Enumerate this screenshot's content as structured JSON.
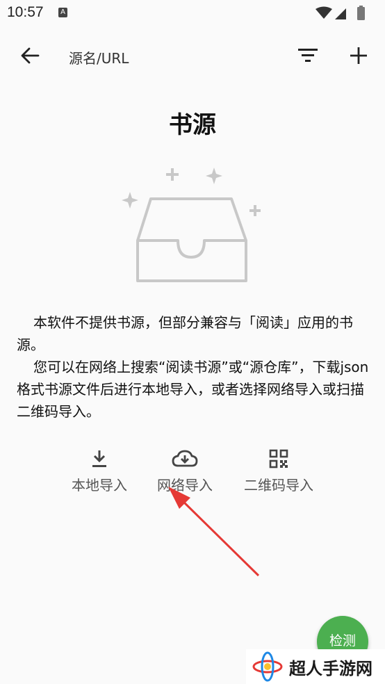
{
  "status_bar": {
    "time": "10:57",
    "notif_letter": "A"
  },
  "toolbar": {
    "back_icon": "arrow-left-icon",
    "search_text": "源名/URL",
    "filter_icon": "filter-icon",
    "add_icon": "plus-icon"
  },
  "page": {
    "title": "书源",
    "description_p1": "本软件不提供书源，但部分兼容与「阅读」应用的书源。",
    "description_p2": "您可以在网络上搜索“阅读书源”或“源仓库”，下载json格式书源文件后进行本地导入，或者选择网络导入或扫描二维码导入。"
  },
  "actions": [
    {
      "label": "本地导入",
      "icon": "download-icon"
    },
    {
      "label": "网络导入",
      "icon": "cloud-download-icon"
    },
    {
      "label": "二维码导入",
      "icon": "qr-code-icon"
    }
  ],
  "fab": {
    "label": "检测"
  },
  "watermark": {
    "text": "超人手游网"
  },
  "colors": {
    "fab": "#4caf50",
    "arrow": "#e53935",
    "background": "#fafafa"
  }
}
